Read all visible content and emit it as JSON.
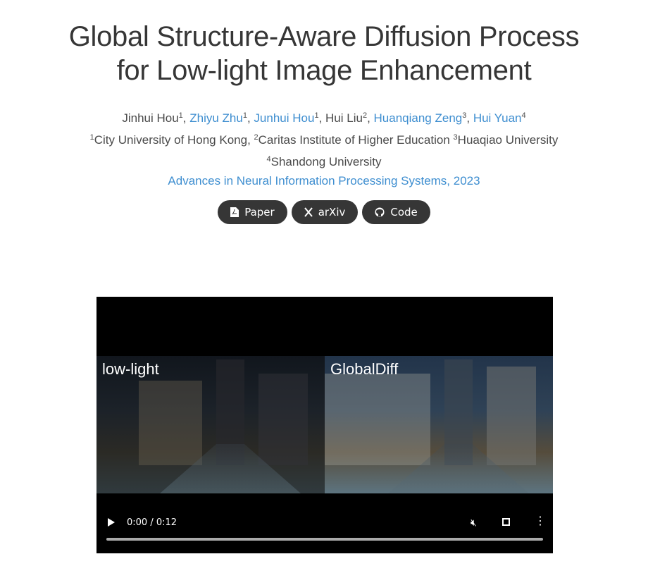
{
  "title": {
    "line1": "Global Structure-Aware Diffusion Process",
    "line2": "for Low-light Image Enhancement"
  },
  "authors": [
    {
      "name": "Jinhui Hou",
      "aff": "1",
      "link": false
    },
    {
      "name": "Zhiyu Zhu",
      "aff": "1",
      "link": true
    },
    {
      "name": "Junhui Hou",
      "aff": "1",
      "link": true
    },
    {
      "name": "Hui Liu",
      "aff": "2",
      "link": false
    },
    {
      "name": "Huanqiang Zeng",
      "aff": "3",
      "link": true
    },
    {
      "name": "Hui Yuan",
      "aff": "4",
      "link": true
    }
  ],
  "affiliations": [
    {
      "num": "1",
      "name": "City University of Hong Kong,"
    },
    {
      "num": "2",
      "name": "Caritas Institute of Higher Education"
    },
    {
      "num": "3",
      "name": "Huaqiao University"
    },
    {
      "num": "4",
      "name": "Shandong University"
    }
  ],
  "venue": "Advances in Neural Information Processing Systems, 2023",
  "buttons": [
    {
      "label": "Paper",
      "icon": "pdf-icon"
    },
    {
      "label": "arXiv",
      "icon": "arxiv-icon"
    },
    {
      "label": "Code",
      "icon": "github-icon"
    }
  ],
  "video": {
    "left_label": "low-light",
    "right_label": "GlobalDiff",
    "time": "0:00 / 0:12",
    "progress": 0
  }
}
